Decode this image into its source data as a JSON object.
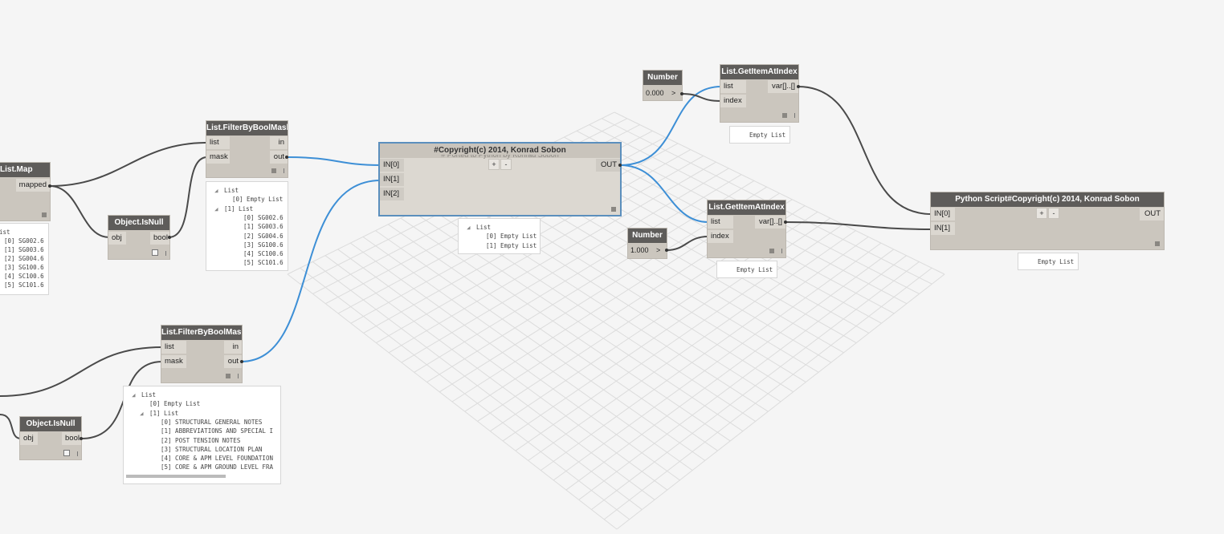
{
  "colors": {
    "wire_grey": "#4a4a4a",
    "wire_blue": "#3d8fd6",
    "node_header": "#5e5c5a",
    "node_body": "#cbc6be"
  },
  "nodes": {
    "list_map": {
      "title": "List.Map",
      "out": "mapped",
      "preview": [
        "ist",
        "[0] SG002.6",
        "[1] SG003.6",
        "[2] SG004.6",
        "[3] SG100.6",
        "[4] SC100.6",
        "[5] SC101.6"
      ]
    },
    "filter1": {
      "title": "List.FilterByBoolMask",
      "in": [
        "list",
        "mask"
      ],
      "out": [
        "in",
        "out"
      ],
      "preview": [
        "List",
        "[0] Empty List",
        "[1] List",
        "[0] SG002.6",
        "[1] SG003.6",
        "[2] SG004.6",
        "[3] SG100.6",
        "[4] SC100.6",
        "[5] SC101.6"
      ]
    },
    "isnull1": {
      "title": "Object.IsNull",
      "in": "obj",
      "out": "bool"
    },
    "filter2": {
      "title": "List.FilterByBoolMask",
      "in": [
        "list",
        "mask"
      ],
      "out": [
        "in",
        "out"
      ],
      "preview": [
        "List",
        "[0] Empty List",
        "[1] List",
        "[0] STRUCTURAL GENERAL NOTES",
        "[1] ABBREVIATIONS AND SPECIAL I",
        "[2] POST TENSION NOTES",
        "[3] STRUCTURAL LOCATION PLAN",
        "[4] CORE & APM LEVEL FOUNDATION",
        "[5] CORE & APM GROUND LEVEL FRA"
      ]
    },
    "isnull2": {
      "title": "Object.IsNull",
      "in": "obj",
      "out": "bool"
    },
    "python1": {
      "title": "#Copyright(c) 2014, Konrad Sobon",
      "subtitle": "# Ported to Python by Konrad Sobon",
      "in": [
        "IN[0]",
        "IN[1]",
        "IN[2]"
      ],
      "out": "OUT",
      "plus": "+",
      "minus": "-",
      "preview": [
        "List",
        "[0] Empty List",
        "[1] Empty List"
      ]
    },
    "number1": {
      "title": "Number",
      "value": "0.000",
      "arrow": ">"
    },
    "getitem1": {
      "title": "List.GetItemAtIndex",
      "in": [
        "list",
        "index"
      ],
      "out": "var[]..[]",
      "preview": "Empty List"
    },
    "number2": {
      "title": "Number",
      "value": "1.000",
      "arrow": ">"
    },
    "getitem2": {
      "title": "List.GetItemAtIndex",
      "in": [
        "list",
        "index"
      ],
      "out": "var[]..[]",
      "preview": "Empty List"
    },
    "python2": {
      "title": "Python Script#Copyright(c) 2014, Konrad Sobon",
      "in": [
        "IN[0]",
        "IN[1]"
      ],
      "out": "OUT",
      "plus": "+",
      "minus": "-",
      "preview": "Empty List"
    }
  }
}
